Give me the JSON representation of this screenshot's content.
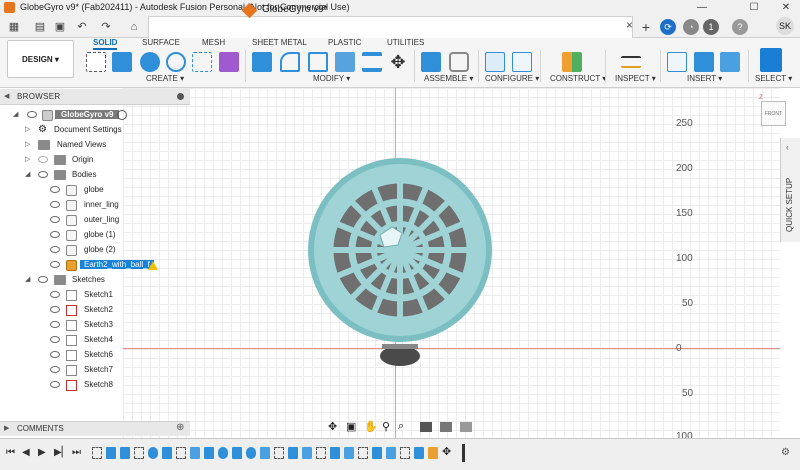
{
  "window": {
    "title": "GlobeGyro v9* (Fab202411) - Autodesk Fusion Personal (Not for Commercial Use)",
    "controls": [
      "minimize",
      "maximize",
      "close"
    ]
  },
  "document_tab": {
    "label": "GlobeGyro v9*",
    "close": "×"
  },
  "user": {
    "initials": "SK",
    "notifications": "1"
  },
  "workspace": {
    "label": "DESIGN ▾"
  },
  "ribbon": {
    "tabs": [
      "SOLID",
      "SURFACE",
      "MESH",
      "SHEET METAL",
      "PLASTIC",
      "UTILITIES"
    ],
    "active_tab": "SOLID",
    "groups": [
      "CREATE ▾",
      "MODIFY ▾",
      "ASSEMBLE ▾",
      "CONFIGURE ▾",
      "CONSTRUCT ▾",
      "INSPECT ▾",
      "INSERT ▾",
      "SELECT ▾"
    ]
  },
  "browser": {
    "header": "BROWSER",
    "root": "GlobeGyro v9",
    "items": [
      {
        "label": "Document Settings",
        "icon": "gear-icon"
      },
      {
        "label": "Named Views",
        "icon": "folder-icon"
      },
      {
        "label": "Origin",
        "icon": "folder-icon"
      },
      {
        "label": "Bodies",
        "icon": "folder-icon"
      }
    ],
    "bodies": [
      "globe",
      "inner_ling",
      "outer_ling",
      "globe (1)",
      "globe (2)"
    ],
    "selected_body": "Earth2_with_ball_f",
    "sketches_label": "Sketches",
    "sketches": [
      "Sketch1",
      "Sketch2",
      "Sketch3",
      "Sketch4",
      "Sketch6",
      "Sketch7",
      "Sketch8"
    ]
  },
  "viewport": {
    "ruler_labels": [
      "250",
      "200",
      "150",
      "100",
      "50",
      "0",
      "50",
      "100"
    ],
    "viewcube_label": "FRONT",
    "quick_setup": "QUICK SETUP"
  },
  "comments": {
    "label": "COMMENTS"
  },
  "colors": {
    "accent": "#0d6fb8",
    "model": "#9fd3d6",
    "model_dark": "#6fb0b5",
    "selection": "#1682d8"
  }
}
